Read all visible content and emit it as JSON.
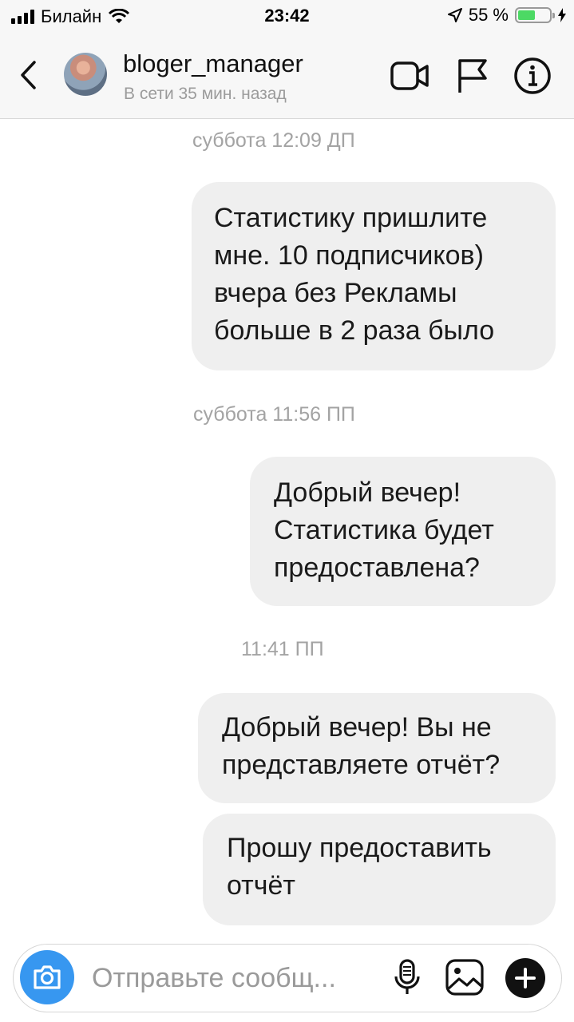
{
  "status_bar": {
    "carrier": "Билайн",
    "time": "23:42",
    "battery_percent": "55 %",
    "battery_level": 0.55
  },
  "header": {
    "username": "bloger_manager",
    "status": "В сети 35 мин. назад",
    "icons": [
      "back-chevron-icon",
      "video-call-icon",
      "flag-icon",
      "info-icon"
    ]
  },
  "messages": [
    {
      "type": "timestamp",
      "text": "суббота 12:09 ДП"
    },
    {
      "type": "bubble",
      "lines": [
        "Статистику пришлите",
        "мне. 10 подписчиков)",
        "вчера без Рекламы",
        "больше в 2 раза было"
      ]
    },
    {
      "type": "timestamp",
      "text": "суббота 11:56 ПП"
    },
    {
      "type": "bubble",
      "lines": [
        "Добрый вечер!",
        "Статистика будет",
        "предоставлена?"
      ]
    },
    {
      "type": "timestamp",
      "text": "11:41 ПП"
    },
    {
      "type": "bubble",
      "lines": [
        "Добрый вечер! Вы не",
        "представляете отчёт?"
      ]
    },
    {
      "type": "bubble",
      "lines": [
        "Прошу предоставить",
        "отчёт"
      ]
    }
  ],
  "composer": {
    "placeholder": "Отправьте сообщ...",
    "icons": [
      "camera-icon",
      "microphone-icon",
      "gallery-icon",
      "plus-icon"
    ]
  },
  "colors": {
    "accent": "#3797f0",
    "bubble": "#efefef",
    "battery_fill": "#4cd964",
    "muted_text": "#a3a3a3"
  }
}
